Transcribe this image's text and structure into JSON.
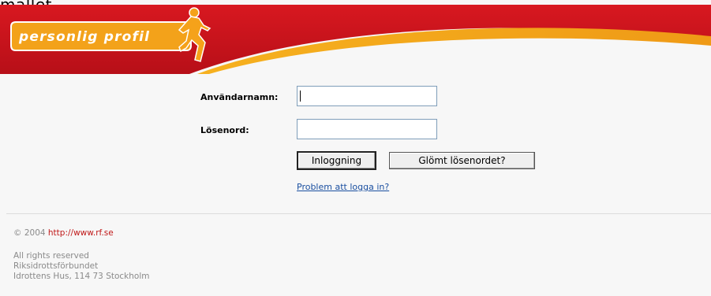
{
  "page": {
    "top_cut_title": "mallet"
  },
  "header": {
    "logo_text": "personlig profil",
    "colors": {
      "red": "#c4121c",
      "orange": "#f3a21a",
      "white": "#ffffff"
    }
  },
  "form": {
    "username_label": "Användarnamn:",
    "username_value": "",
    "password_label": "Lösenord:",
    "password_value": "",
    "login_button": "Inloggning",
    "forgot_button": "Glömt lösenordet?",
    "problem_link": "Problem att logga in?"
  },
  "footer": {
    "copyright_prefix": "© 2004",
    "site_link": "http://www.rf.se",
    "rights": "All rights reserved",
    "org": "Riksidrottsförbundet",
    "address": "Idrottens Hus, 114 73 Stockholm"
  }
}
